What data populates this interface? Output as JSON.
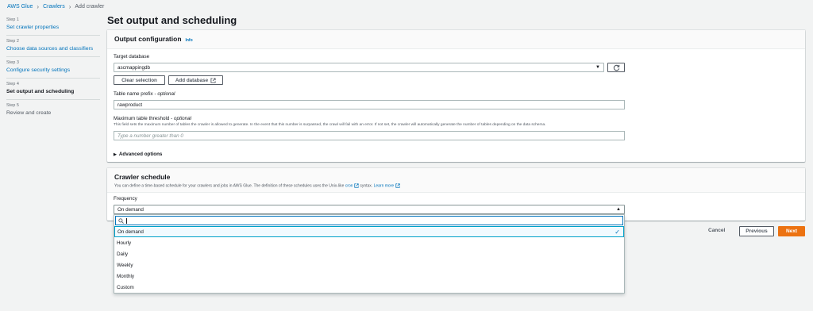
{
  "breadcrumb": {
    "items": [
      "AWS Glue",
      "Crawlers",
      "Add crawler"
    ]
  },
  "steps": [
    {
      "num": "Step 1",
      "label": "Set crawler properties",
      "state": "link"
    },
    {
      "num": "Step 2",
      "label": "Choose data sources and classifiers",
      "state": "link"
    },
    {
      "num": "Step 3",
      "label": "Configure security settings",
      "state": "link"
    },
    {
      "num": "Step 4",
      "label": "Set output and scheduling",
      "state": "active"
    },
    {
      "num": "Step 5",
      "label": "Review and create",
      "state": "disabled"
    }
  ],
  "page": {
    "title": "Set output and scheduling"
  },
  "output": {
    "title": "Output configuration",
    "info": "Info",
    "target_db_label": "Target database",
    "target_db_value": "ascmappingdb",
    "clear_label": "Clear selection",
    "add_db_label": "Add database",
    "prefix_label": "Table name prefix - ",
    "prefix_optional": "optional",
    "prefix_value": "rawproduct",
    "threshold_label": "Maximum table threshold - ",
    "threshold_optional": "optional",
    "threshold_help": "This field sets the maximum number of tables the crawler is allowed to generate. In the event that this number is surpassed, the crawl will fail with an error. If not set, the crawler will automatically generate the number of tables depending on the data schema.",
    "threshold_placeholder": "Type a number greater than 0",
    "advanced_label": "Advanced options"
  },
  "schedule": {
    "title": "Crawler schedule",
    "desc_prefix": "You can define a time-based schedule for your crawlers and jobs in AWS Glue. The definition of these schedules uses the Unix-like ",
    "cron_link": "cron",
    "desc_mid": " syntax. ",
    "learn_more": "Learn more",
    "frequency_label": "Frequency",
    "frequency_value": "On demand",
    "options": [
      "On demand",
      "Hourly",
      "Daily",
      "Weekly",
      "Monthly",
      "Custom"
    ],
    "selected_option": "On demand"
  },
  "footer": {
    "cancel": "Cancel",
    "previous": "Previous",
    "next": "Next"
  },
  "colors": {
    "link": "#0073bb",
    "primary": "#ec7211",
    "selected_bg": "#f1faff"
  }
}
